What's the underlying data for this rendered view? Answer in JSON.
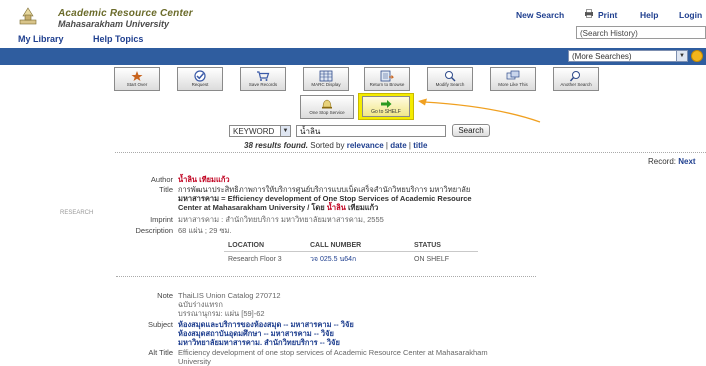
{
  "header": {
    "title": "Academic Resource Center",
    "subtitle": "Mahasarakham University",
    "links": [
      "New Search",
      "Print",
      "Help",
      "Login"
    ],
    "nav": [
      "My Library",
      "Help Topics"
    ],
    "history": "(Search History)"
  },
  "bar": {
    "more_searches": "(More Searches)"
  },
  "toolbar": {
    "row1": [
      "Start Over",
      "Request",
      "Save Records",
      "MARC Display",
      "Return to Browse",
      "Modify Search",
      "More Like This",
      "Another Search"
    ],
    "row2": [
      "One Stop Service",
      "Go to SHELF"
    ]
  },
  "search": {
    "type": "KEYWORD",
    "query": "น้ำลิน",
    "button": "Search"
  },
  "results": {
    "count": "38 results found.",
    "sorted": "Sorted by",
    "relevance": "relevance",
    "sep1": "|",
    "date": "date",
    "sep2": "|",
    "title": "title"
  },
  "record_nav": {
    "label": "Record:",
    "next": "Next"
  },
  "thumb_label": "RESEARCH",
  "record": {
    "author_label": "Author",
    "author": "น้ำลิน เทียมแก้ว",
    "title_label": "Title",
    "title_line1": "การพัฒนาประสิทธิภาพการให้บริการศูนย์บริการแบบเบ็ดเสร็จสำนักวิทยบริการ มหาวิทยาลัย",
    "title_line2": "มหาสารคาม = Efficiency development of One Stop Services of Academic Resource",
    "title_line3_a": "Center at Mahasarakham University / โดย",
    "title_line3_b": "น้ำลิน",
    "title_line3_c": "เทียมแก้ว",
    "imprint_label": "Imprint",
    "imprint": "มหาสารคาม : สำนักวิทยบริการ มหาวิทยาลัยมหาสารคาม, 2555",
    "desc_label": "Description",
    "desc": "68 แผ่น ; 29 ซม.",
    "holdings": {
      "headers": [
        "LOCATION",
        "CALL NUMBER",
        "STATUS"
      ],
      "row": [
        "Research Floor 3",
        "วจ 025.5 น64ก",
        "ON SHELF"
      ]
    },
    "note_label": "Note",
    "notes": [
      "ThaiLIS Union Catalog 270712",
      "ฉบับร่างแทรก",
      "บรรณานุกรม: แผ่น [59]-62"
    ],
    "subject_label": "Subject",
    "subjects": [
      "ห้องสมุดและบริการของห้องสมุด -- มหาสารคาม -- วิจัย",
      "ห้องสมุดสถาบันอุดมศึกษา -- มหาสารคาม -- วิจัย",
      "มหาวิทยาลัยมหาสารคาม. สำนักวิทยบริการ -- วิจัย"
    ],
    "alt_label": "Alt Title",
    "alt_line1": "Efficiency development of one stop services of Academic Resource Center at Mahasarakham",
    "alt_line2": "University"
  },
  "colors": {
    "bar": "#2f5d9f",
    "link": "#1f3f8f",
    "highlight": "#f4ec00",
    "author": "#c0001f"
  }
}
